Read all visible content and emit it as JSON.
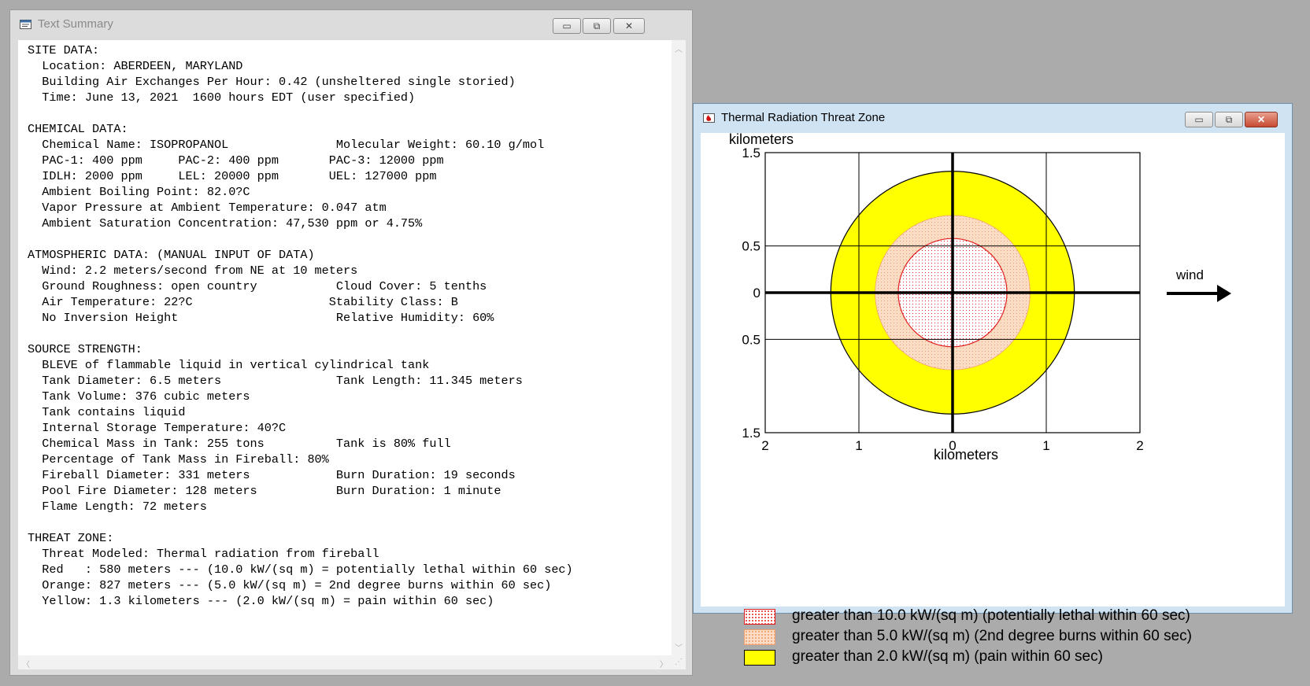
{
  "text_summary": {
    "title": "Text Summary",
    "buttons": {
      "minimize": "▭",
      "maximize": "⧉",
      "close": "✕"
    },
    "lines": [
      "SITE DATA:",
      "  Location: ABERDEEN, MARYLAND",
      "  Building Air Exchanges Per Hour: 0.42 (unsheltered single storied)",
      "  Time: June 13, 2021  1600 hours EDT (user specified)",
      "",
      "CHEMICAL DATA:",
      "  Chemical Name: ISOPROPANOL               Molecular Weight: 60.10 g/mol",
      "  PAC-1: 400 ppm     PAC-2: 400 ppm       PAC-3: 12000 ppm",
      "  IDLH: 2000 ppm     LEL: 20000 ppm       UEL: 127000 ppm",
      "  Ambient Boiling Point: 82.0?C",
      "  Vapor Pressure at Ambient Temperature: 0.047 atm",
      "  Ambient Saturation Concentration: 47,530 ppm or 4.75%",
      "",
      "ATMOSPHERIC DATA: (MANUAL INPUT OF DATA)",
      "  Wind: 2.2 meters/second from NE at 10 meters",
      "  Ground Roughness: open country           Cloud Cover: 5 tenths",
      "  Air Temperature: 22?C                   Stability Class: B",
      "  No Inversion Height                      Relative Humidity: 60%",
      "",
      "SOURCE STRENGTH:",
      "  BLEVE of flammable liquid in vertical cylindrical tank",
      "  Tank Diameter: 6.5 meters                Tank Length: 11.345 meters",
      "  Tank Volume: 376 cubic meters",
      "  Tank contains liquid",
      "  Internal Storage Temperature: 40?C",
      "  Chemical Mass in Tank: 255 tons          Tank is 80% full",
      "  Percentage of Tank Mass in Fireball: 80%",
      "  Fireball Diameter: 331 meters            Burn Duration: 19 seconds",
      "  Pool Fire Diameter: 128 meters           Burn Duration: 1 minute",
      "  Flame Length: 72 meters",
      "",
      "THREAT ZONE:",
      "  Threat Modeled: Thermal radiation from fireball",
      "  Red   : 580 meters --- (10.0 kW/(sq m) = potentially lethal within 60 sec)",
      "  Orange: 827 meters --- (5.0 kW/(sq m) = 2nd degree burns within 60 sec)",
      "  Yellow: 1.3 kilometers --- (2.0 kW/(sq m) = pain within 60 sec)"
    ]
  },
  "threat_zone": {
    "title": "Thermal Radiation Threat Zone",
    "buttons": {
      "minimize": "▭",
      "maximize": "⧉",
      "close": "✕"
    },
    "wind_label": "wind",
    "colors": {
      "red": "#e02020",
      "orange_fill": "#fbdcc4",
      "yellow": "#ffff00"
    },
    "legend": [
      {
        "label": "greater than 10.0 kW/(sq m) (potentially lethal within 60 sec)",
        "swatch": "red-dotted"
      },
      {
        "label": "greater than 5.0 kW/(sq m) (2nd degree burns within 60 sec)",
        "swatch": "orange-dotted"
      },
      {
        "label": "greater than 2.0 kW/(sq m) (pain within 60 sec)",
        "swatch": "yellow"
      }
    ]
  },
  "chart_data": {
    "type": "threat-zone-plot",
    "x_axis_label": "kilometers",
    "y_axis_label": "kilometers",
    "x_ticks": [
      "2",
      "1",
      "0",
      "1",
      "2"
    ],
    "y_ticks": [
      "1.5",
      "0.5",
      "0",
      "0.5",
      "1.5"
    ],
    "x_range_km": [
      -2,
      2
    ],
    "y_range_km": [
      -1.5,
      1.5
    ],
    "grid": true,
    "zones": [
      {
        "name": "Yellow",
        "radius_km": 1.3,
        "color": "#ffff00"
      },
      {
        "name": "Orange",
        "radius_km": 0.827,
        "color": "#fbdcc4"
      },
      {
        "name": "Red",
        "radius_km": 0.58,
        "color": "#ffffff"
      }
    ]
  }
}
